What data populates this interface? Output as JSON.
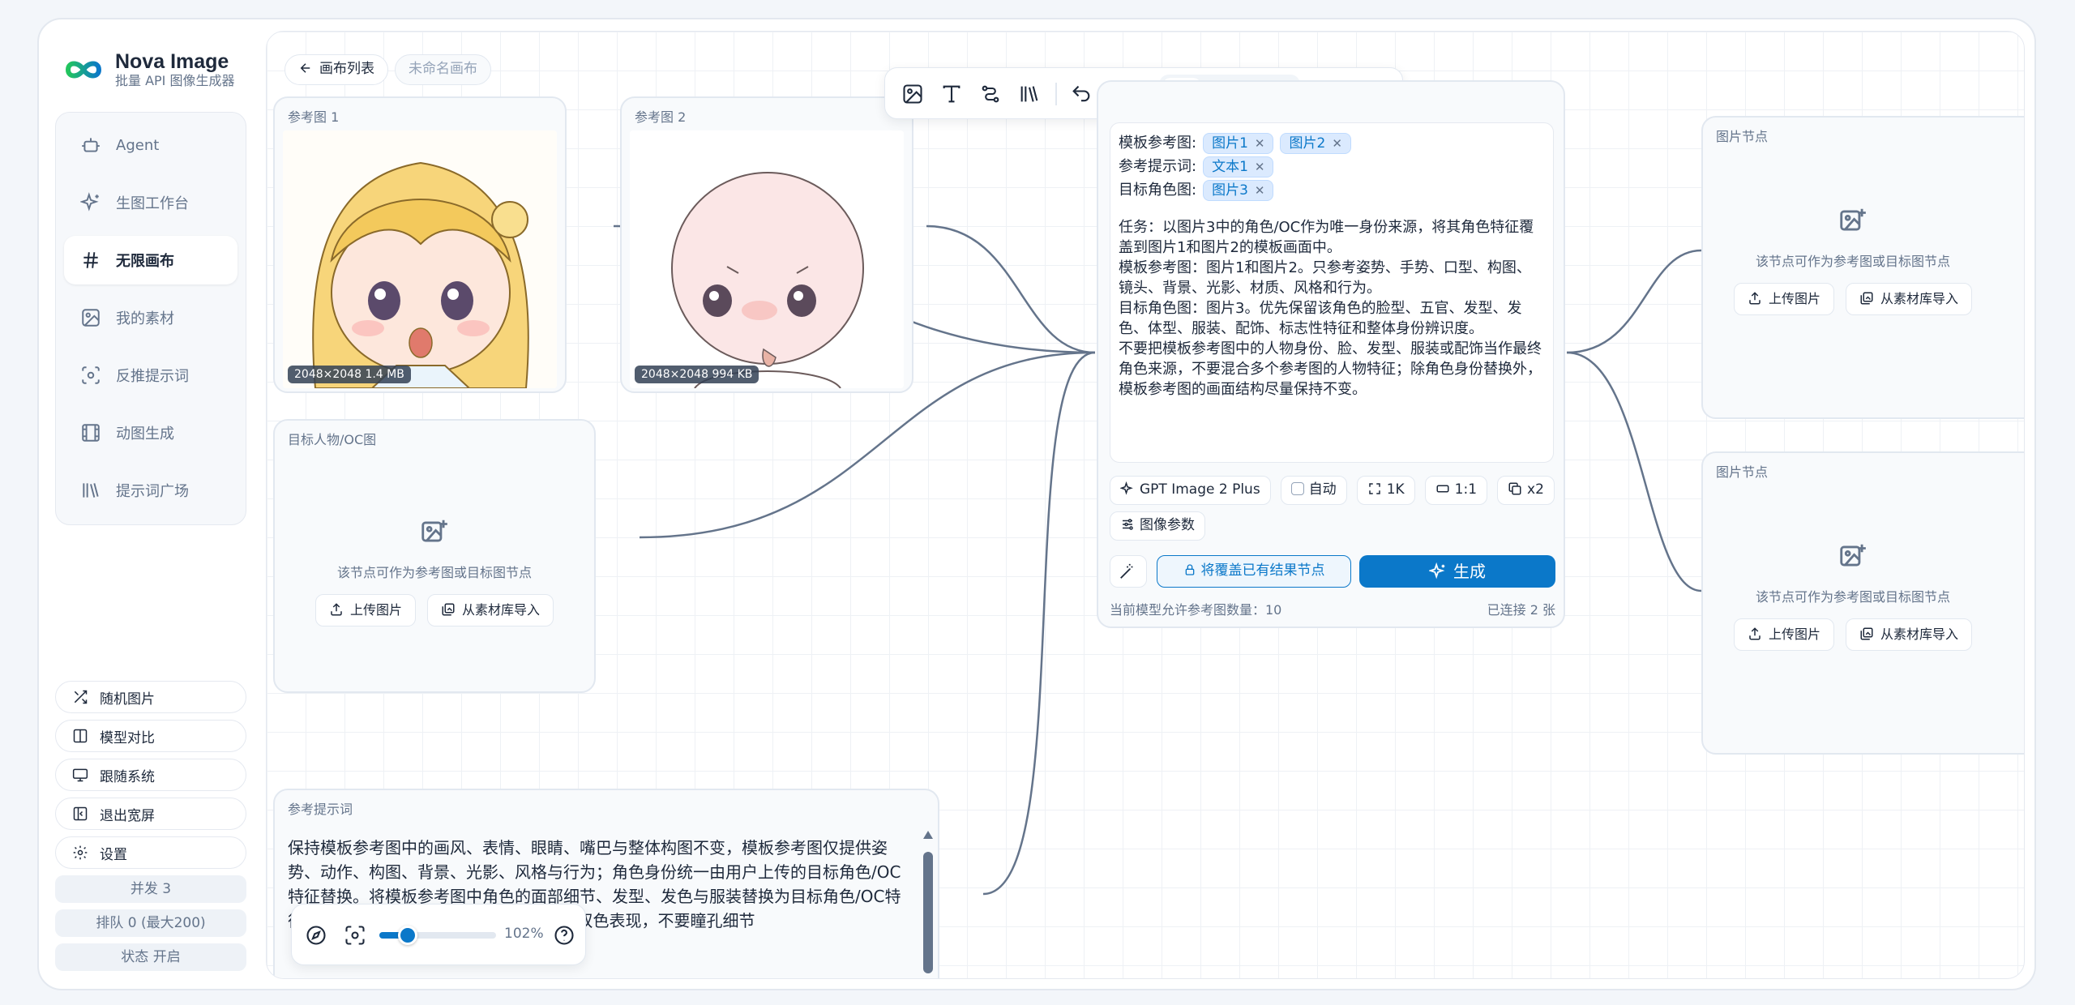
{
  "app": {
    "name": "Nova Image",
    "subtitle": "批量 API 图像生成器"
  },
  "sidebar": {
    "items": [
      {
        "label": "Agent",
        "icon": "robot-icon"
      },
      {
        "label": "生图工作台",
        "icon": "sparkle-icon"
      },
      {
        "label": "无限画布",
        "icon": "hash-icon",
        "active": true
      },
      {
        "label": "我的素材",
        "icon": "image-icon"
      },
      {
        "label": "反推提示词",
        "icon": "scan-icon"
      },
      {
        "label": "动图生成",
        "icon": "film-icon"
      },
      {
        "label": "提示词广场",
        "icon": "library-icon"
      }
    ],
    "buttons": [
      {
        "label": "随机图片",
        "icon": "shuffle-icon"
      },
      {
        "label": "模型对比",
        "icon": "columns-icon"
      },
      {
        "label": "跟随系统",
        "icon": "monitor-icon"
      },
      {
        "label": "退出宽屏",
        "icon": "collapse-icon"
      },
      {
        "label": "设置",
        "icon": "gear-icon"
      }
    ],
    "stats": {
      "concurrency": "并发 3",
      "queue": "排队 0 (最大200)",
      "status": "状态 开启"
    }
  },
  "canvas": {
    "back_label": "画布列表",
    "canvas_name": "未命名画布",
    "ref1": {
      "title": "参考图 1",
      "meta": "2048×2048 1.4 MB"
    },
    "ref2": {
      "title": "参考图 2",
      "meta": "2048×2048 994 KB"
    },
    "target": {
      "title": "目标人物/OC图"
    },
    "empty_hint": "该节点可作为参考图或目标图节点",
    "upload_label": "上传图片",
    "import_label": "从素材库导入",
    "image_node_title": "图片节点",
    "prompt_node": {
      "title": "参考提示词",
      "text": "保持模板参考图中的画风、表情、眼睛、嘴巴与整体构图不变，模板参考图仅提供姿势、动作、构图、背景、光影、风格与行为；角色身份统一由用户上传的目标角色/OC特征替换。将模板参考图中角色的面部细节、发型、发色与服装替换为目标角色/OC特征，瞳色改为目标角色/OC对应颜色，仅双色表现，不要瞳孔细节"
    }
  },
  "generator": {
    "template_label": "模板参考图:",
    "template_chips": [
      "图片1",
      "图片2"
    ],
    "prompt_label": "参考提示词:",
    "prompt_chips": [
      "文本1"
    ],
    "target_label": "目标角色图:",
    "target_chips": [
      "图片3"
    ],
    "task": "任务：以图片3中的角色/OC作为唯一身份来源，将其角色特征覆盖到图片1和图片2的模板画面中。\n模板参考图：图片1和图片2。只参考姿势、手势、口型、构图、镜头、背景、光影、材质、风格和行为。\n目标角色图：图片3。优先保留该角色的脸型、五官、发型、发色、体型、服装、配饰、标志性特征和整体身份辨识度。\n不要把模板参考图中的人物身份、脸、发型、服装或配饰当作最终角色来源，不要混合多个参考图的人物特征；除角色身份替换外，模板参考图的画面结构尽量保持不变。",
    "model": "GPT Image 2 Plus",
    "auto_label": "自动",
    "resolution": "1K",
    "ratio": "1:1",
    "count": "x2",
    "params_label": "图像参数",
    "overwrite_label": "将覆盖已有结果节点",
    "generate_label": "生成",
    "ref_limit": "当前模型允许参考图数量：10",
    "connected": "已连接 2 张"
  },
  "zoom": {
    "percent_label": "102%",
    "level": 0.24
  },
  "colors": {
    "accent": "#0b78c9",
    "chip_bg": "#dbeafe",
    "wire": "#64748b"
  }
}
